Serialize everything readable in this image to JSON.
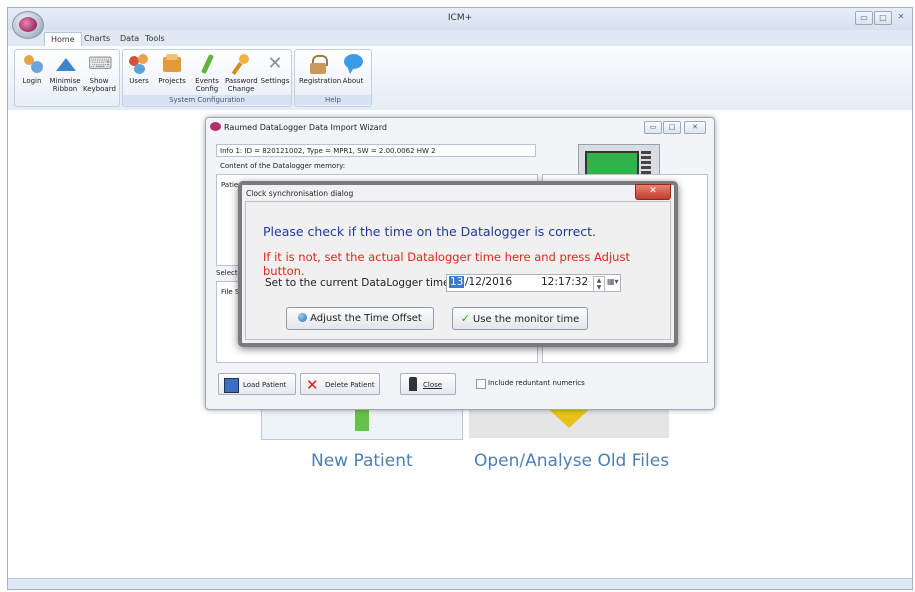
{
  "app": {
    "title": "ICM+"
  },
  "tabs": [
    {
      "label": "Home"
    },
    {
      "label": "Charts"
    },
    {
      "label": "Data"
    },
    {
      "label": "Tools"
    }
  ],
  "ribbon": {
    "groups": [
      {
        "label": "",
        "buttons": [
          {
            "label1": "Login",
            "label2": ""
          },
          {
            "label1": "Minimise",
            "label2": "Ribbon"
          },
          {
            "label1": "Show",
            "label2": "Keyboard"
          }
        ]
      },
      {
        "label": "System Configuration",
        "buttons": [
          {
            "label1": "Users",
            "label2": ""
          },
          {
            "label1": "Projects",
            "label2": ""
          },
          {
            "label1": "Events",
            "label2": "Config"
          },
          {
            "label1": "Password",
            "label2": "Change"
          },
          {
            "label1": "Settings",
            "label2": ""
          }
        ]
      },
      {
        "label": "Help",
        "buttons": [
          {
            "label1": "Registration",
            "label2": ""
          },
          {
            "label1": "About",
            "label2": ""
          }
        ]
      }
    ]
  },
  "background": {
    "new_patient": "New Patient",
    "open_old": "Open/Analyse Old Files"
  },
  "wizard": {
    "title": "Raumed DataLogger Data Import Wizard",
    "info": "Info 1: ID = 820121002, Type = MPR1, SW = 2.00.0062 HW 2",
    "content_label": "Content of the Datalogger memory:",
    "patient_col": "Patie",
    "selected_label": "Selecte",
    "file_col": "File S",
    "load_button": "Load Patient",
    "delete_button": "Delete Patient",
    "close_button": "Close",
    "include_checkbox": "Include reduntant numerics",
    "include_checked": false
  },
  "clock_dialog": {
    "title": "Clock synchronisation dialog",
    "message1": "Please check if the time on the Datalogger is correct.",
    "message2": "If it is not, set the actual Datalogger time here and press Adjust button.",
    "set_label": "Set to the current DataLogger time:",
    "date_day": "13",
    "date_rest": "/12/2016",
    "time": "12:17:32",
    "adjust_button": "Adjust the Time Offset",
    "use_monitor_button": "Use the monitor time"
  },
  "colors": {
    "message1": "#1d3b9c",
    "message2": "#e0281a",
    "accent": "#4d7fb5"
  }
}
